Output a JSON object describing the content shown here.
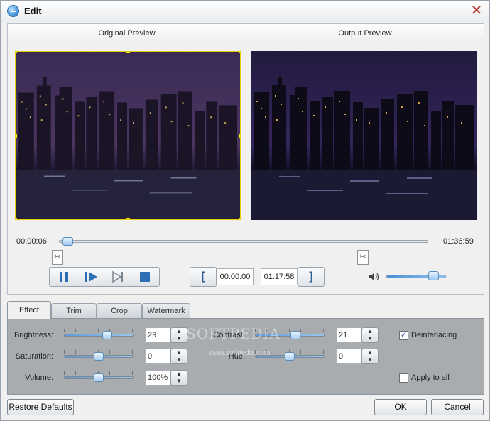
{
  "window": {
    "title": "Edit"
  },
  "preview": {
    "original_label": "Original Preview",
    "output_label": "Output Preview"
  },
  "timeline": {
    "current_time": "00:00:06",
    "total_time": "01:36:59",
    "position_fraction": 0.01
  },
  "trim": {
    "start_time": "00:00:00",
    "end_time": "01:17:58"
  },
  "player": {
    "volume_fraction": 0.85
  },
  "tabs": [
    {
      "label": "Effect",
      "active": true
    },
    {
      "label": "Trim",
      "active": false
    },
    {
      "label": "Crop",
      "active": false
    },
    {
      "label": "Watermark",
      "active": false
    }
  ],
  "effect": {
    "brightness": {
      "label": "Brightness:",
      "value": "29",
      "fraction": 0.64
    },
    "saturation": {
      "label": "Saturation:",
      "value": "0",
      "fraction": 0.5
    },
    "volume": {
      "label": "Volume:",
      "value": "100%",
      "fraction": 0.5
    },
    "contrast": {
      "label": "Contrast:",
      "value": "21",
      "fraction": 0.6
    },
    "hue": {
      "label": "Hue:",
      "value": "0",
      "fraction": 0.5
    },
    "deinterlacing": {
      "label": "Deinterlacing",
      "checked": true
    },
    "apply_to_all": {
      "label": "Apply to all",
      "checked": false
    }
  },
  "watermark_overlay": {
    "text": "SOFTPEDIA",
    "sub": "www.softpedia.com"
  },
  "buttons": {
    "restore": "Restore Defaults",
    "ok": "OK",
    "cancel": "Cancel"
  }
}
